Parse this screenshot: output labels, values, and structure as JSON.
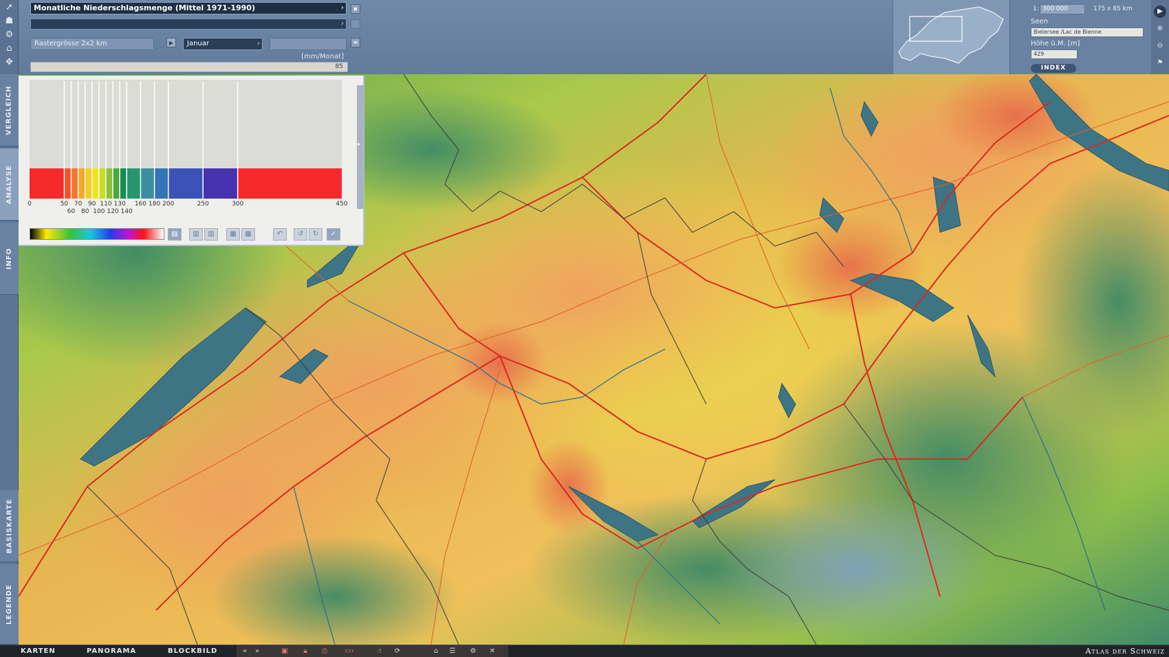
{
  "header": {
    "map_title": "Monatliche Niederschlagsmenge (Mittel 1971-1990)",
    "raster_size": "Rastergrösse 2x2 km",
    "month": "Januar",
    "unit": "[mm/Monat]",
    "current_value": "85"
  },
  "legend": {
    "classes_upper": [
      "0",
      "50",
      "70",
      "90",
      "110",
      "130",
      "160",
      "180",
      "200",
      "250",
      "300",
      "450"
    ],
    "classes_lower": [
      "60",
      "80",
      "100",
      "120",
      "140"
    ],
    "class_colors": [
      "#f62a2a",
      "#f5502a",
      "#f5752a",
      "#f6a72b",
      "#f7cc26",
      "#f1e41e",
      "#c9dc27",
      "#8bc13a",
      "#4aa741",
      "#1c8a52",
      "#27966f",
      "#3b8ea0",
      "#3474b8",
      "#3b53b8",
      "#4733b0"
    ]
  },
  "sidetabs": {
    "vergleich": "VERGLEICH",
    "analyse": "ANALYSE",
    "info": "INFO",
    "basiskarte": "BASISKARTE",
    "legende": "LEGENDE"
  },
  "info_panel": {
    "scale_prefix": "1:",
    "scale": "300 000",
    "extent": "175 x 85 km",
    "lake_label": "Seen",
    "lake_value": "Bielersee /Lac de Bienne",
    "height_label": "Höhe ü.M. [m]",
    "height_value": "429",
    "index_button": "INDEX"
  },
  "bottom_nav": {
    "karten": "KARTEN",
    "panorama": "PANORAMA",
    "blockbild": "BLOCKBILD",
    "atlas": "Atlas der Schweiz"
  },
  "icons": {
    "toolstrip": [
      "pointer-icon",
      "people-icon",
      "gear-icon",
      "building-icon",
      "puzzle-icon"
    ],
    "right": [
      "play-icon",
      "zoom-in-icon",
      "zoom-out-icon",
      "flag-icon"
    ],
    "bottom": [
      "back-icon",
      "forward-icon",
      "layers-icon",
      "lock-icon",
      "print-icon",
      "export-icon",
      "hand-icon",
      "rotate-icon",
      "home-icon",
      "list-icon",
      "settings-icon",
      "close-icon"
    ]
  }
}
